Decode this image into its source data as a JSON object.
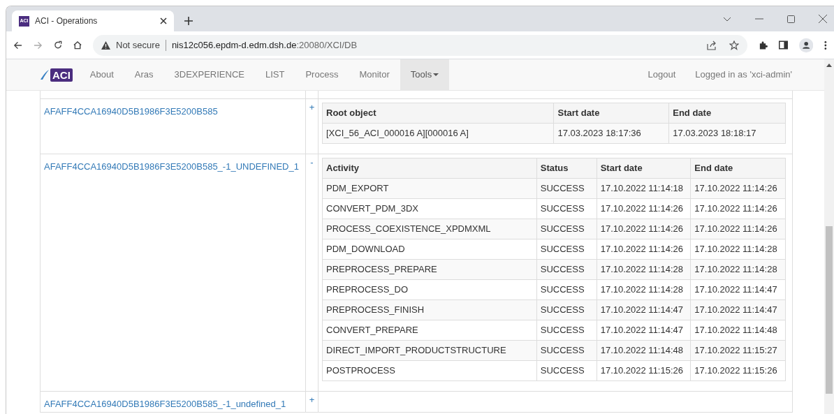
{
  "browser": {
    "favicon": "ACI",
    "tab_title": "ACI - Operations",
    "security": "Not secure",
    "url_host": "nis12c056.epdm-d.edm.dsh.de",
    "url_rest": ":20080/XCI/DB"
  },
  "nav": {
    "brand": "ACI",
    "items": [
      {
        "label": "About",
        "selected": false,
        "dropdown": false
      },
      {
        "label": "Aras",
        "selected": false,
        "dropdown": false
      },
      {
        "label": "3DEXPERIENCE",
        "selected": false,
        "dropdown": false
      },
      {
        "label": "LIST",
        "selected": false,
        "dropdown": false
      },
      {
        "label": "Process",
        "selected": false,
        "dropdown": false
      },
      {
        "label": "Monitor",
        "selected": false,
        "dropdown": false
      },
      {
        "label": "Tools",
        "selected": true,
        "dropdown": true
      }
    ],
    "right_items": [
      "Logout",
      "Logged in as 'xci-admin'"
    ]
  },
  "sections": [
    {
      "link": "AFAFF4CCA16940D5B1986F3E5200B585",
      "toggle": "+",
      "table": {
        "kind": "root",
        "columns": [
          "Root object",
          "Start date",
          "End date"
        ],
        "rows": [
          [
            "[XCI_56_ACI_000016 A][000016 A]",
            "17.03.2023 18:17:36",
            "17.03.2023 18:18:17"
          ]
        ]
      }
    },
    {
      "link": "AFAFF4CCA16940D5B1986F3E5200B585_-1_UNDEFINED_1",
      "toggle": "-",
      "table": {
        "kind": "activity",
        "columns": [
          "Activity",
          "Status",
          "Start date",
          "End date"
        ],
        "rows": [
          [
            "PDM_EXPORT",
            "SUCCESS",
            "17.10.2022 11:14:18",
            "17.10.2022 11:14:26"
          ],
          [
            "CONVERT_PDM_3DX",
            "SUCCESS",
            "17.10.2022 11:14:26",
            "17.10.2022 11:14:26"
          ],
          [
            "PROCESS_COEXISTENCE_XPDMXML",
            "SUCCESS",
            "17.10.2022 11:14:26",
            "17.10.2022 11:14:26"
          ],
          [
            "PDM_DOWNLOAD",
            "SUCCESS",
            "17.10.2022 11:14:26",
            "17.10.2022 11:14:28"
          ],
          [
            "PREPROCESS_PREPARE",
            "SUCCESS",
            "17.10.2022 11:14:28",
            "17.10.2022 11:14:28"
          ],
          [
            "PREPROCESS_DO",
            "SUCCESS",
            "17.10.2022 11:14:28",
            "17.10.2022 11:14:47"
          ],
          [
            "PREPROCESS_FINISH",
            "SUCCESS",
            "17.10.2022 11:14:47",
            "17.10.2022 11:14:47"
          ],
          [
            "CONVERT_PREPARE",
            "SUCCESS",
            "17.10.2022 11:14:47",
            "17.10.2022 11:14:48"
          ],
          [
            "DIRECT_IMPORT_PRODUCTSTRUCTURE",
            "SUCCESS",
            "17.10.2022 11:14:48",
            "17.10.2022 11:15:27"
          ],
          [
            "POSTPROCESS",
            "SUCCESS",
            "17.10.2022 11:15:26",
            "17.10.2022 11:15:26"
          ]
        ]
      }
    },
    {
      "link": "AFAFF4CCA16940D5B1986F3E5200B585_-1_undefined_1",
      "toggle": "+"
    }
  ]
}
